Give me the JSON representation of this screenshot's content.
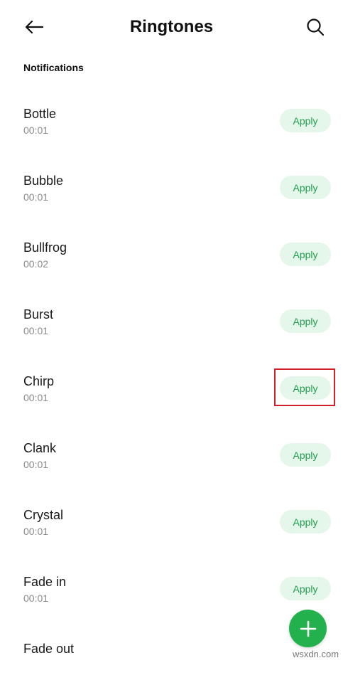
{
  "header": {
    "title": "Ringtones",
    "back_icon": "arrow-left-icon",
    "search_icon": "search-icon"
  },
  "section": {
    "label": "Notifications"
  },
  "ringtones": [
    {
      "name": "Bottle",
      "duration": "00:01",
      "action": "Apply"
    },
    {
      "name": "Bubble",
      "duration": "00:01",
      "action": "Apply"
    },
    {
      "name": "Bullfrog",
      "duration": "00:02",
      "action": "Apply"
    },
    {
      "name": "Burst",
      "duration": "00:01",
      "action": "Apply"
    },
    {
      "name": "Chirp",
      "duration": "00:01",
      "action": "Apply"
    },
    {
      "name": "Clank",
      "duration": "00:01",
      "action": "Apply"
    },
    {
      "name": "Crystal",
      "duration": "00:01",
      "action": "Apply"
    },
    {
      "name": "Fade in",
      "duration": "00:01",
      "action": "Apply"
    },
    {
      "name": "Fade out",
      "duration": "",
      "action": ""
    }
  ],
  "fab": {
    "icon": "plus-icon"
  },
  "watermark": "wsxdn.com",
  "colors": {
    "accent": "#22b14c",
    "apply_bg": "#e5f6ea",
    "apply_text": "#1f9e4d",
    "highlight": "#d0202a"
  }
}
